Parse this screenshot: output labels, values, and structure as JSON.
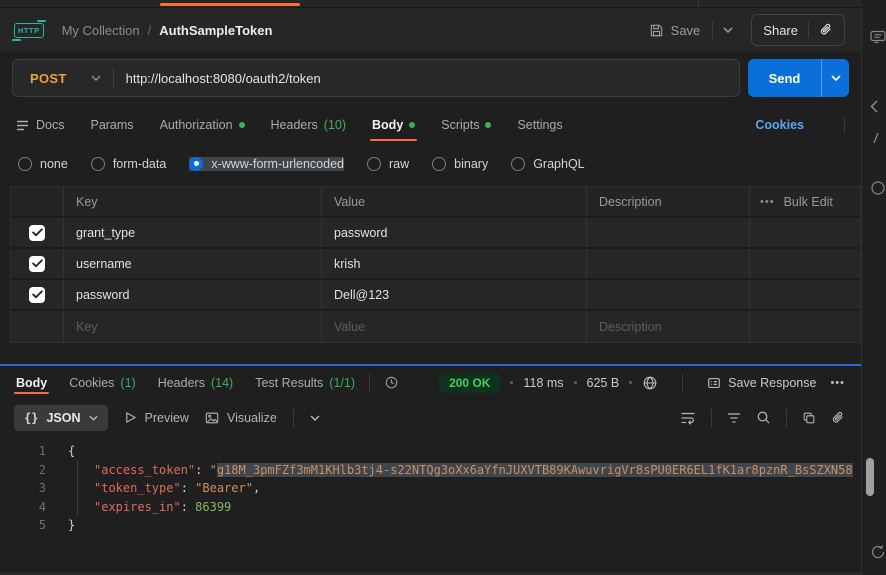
{
  "topbar": {
    "breadcrumb_collection": "My Collection",
    "breadcrumb_separator": "/",
    "breadcrumb_request": "AuthSampleToken",
    "save_label": "Save",
    "share_label": "Share"
  },
  "request_bar": {
    "method": "POST",
    "url": "http://localhost:8080/oauth2/token",
    "send_label": "Send"
  },
  "request_tabs": {
    "docs_label": "Docs",
    "items": [
      {
        "label": "Params"
      },
      {
        "label": "Authorization",
        "dot": true
      },
      {
        "label": "Headers",
        "badge": "(10)"
      },
      {
        "label": "Body",
        "dot": true,
        "active": true
      },
      {
        "label": "Scripts",
        "dot": true
      },
      {
        "label": "Settings"
      }
    ],
    "cookies_link": "Cookies"
  },
  "body_types": {
    "options": [
      {
        "label": "none"
      },
      {
        "label": "form-data"
      },
      {
        "label": "x-www-form-urlencoded",
        "selected": true
      },
      {
        "label": "raw"
      },
      {
        "label": "binary"
      },
      {
        "label": "GraphQL"
      }
    ]
  },
  "form_table": {
    "headers": {
      "key": "Key",
      "value": "Value",
      "description": "Description",
      "bulk_edit": "Bulk Edit"
    },
    "rows": [
      {
        "key": "grant_type",
        "value": "password",
        "description": "",
        "checked": true
      },
      {
        "key": "username",
        "value": "krish",
        "description": "",
        "checked": true
      },
      {
        "key": "password",
        "value": "Dell@123",
        "description": "",
        "checked": true
      }
    ],
    "placeholder_row": {
      "key": "Key",
      "value": "Value",
      "description": "Description"
    }
  },
  "response": {
    "tabs": [
      {
        "label": "Body",
        "active": true
      },
      {
        "label": "Cookies",
        "badge": "(1)"
      },
      {
        "label": "Headers",
        "badge": "(14)"
      },
      {
        "label": "Test Results",
        "badge": "(1/1)"
      }
    ],
    "status": "200 OK",
    "time": "118 ms",
    "size": "625 B",
    "save_response_label": "Save Response",
    "format_label": "JSON",
    "preview_label": "Preview",
    "visualize_label": "Visualize",
    "body": {
      "access_token": "g18M_3pmFZf3mM1KHlb3tj4-s22NTQg3oXx6aYfnJUXVTB89KAwuvrigVr8sPU0ER6EL1fK1ar8pznR_BsSZXN58",
      "token_type": "Bearer",
      "expires_in": 86399
    },
    "code_lines": [
      {
        "num": "1",
        "indent": false,
        "segments": [
          {
            "t": "{",
            "c": "punc"
          }
        ]
      },
      {
        "num": "2",
        "indent": true,
        "segments": [
          {
            "t": "\"access_token\"",
            "c": "key"
          },
          {
            "t": ": ",
            "c": "punc"
          },
          {
            "t": "\"",
            "c": "str"
          },
          {
            "t": "g18M_3pmFZf3mM1KHlb3tj4-s22NTQg3oXx6aYfnJUXVTB89KAwuvrigVr8sPU0ER6EL1fK1ar8pznR_BsSZXN58",
            "c": "str sel"
          }
        ]
      },
      {
        "num": "3",
        "indent": true,
        "segments": [
          {
            "t": "\"token_type\"",
            "c": "key"
          },
          {
            "t": ": ",
            "c": "punc"
          },
          {
            "t": "\"Bearer\"",
            "c": "str"
          },
          {
            "t": ",",
            "c": "punc"
          }
        ]
      },
      {
        "num": "4",
        "indent": true,
        "segments": [
          {
            "t": "\"expires_in\"",
            "c": "key"
          },
          {
            "t": ": ",
            "c": "punc"
          },
          {
            "t": "86399",
            "c": "num"
          }
        ]
      },
      {
        "num": "5",
        "indent": false,
        "segments": [
          {
            "t": "}",
            "c": "punc"
          }
        ]
      }
    ]
  },
  "icons": {
    "more_horizontal": "•••",
    "braces": "{}",
    "http_badge": "HTTP"
  },
  "colors": {
    "accent_orange": "#ff6c37",
    "method_post": "#eea23d",
    "primary_blue": "#0b6fdb",
    "success_green": "#3faf5f",
    "status_badge_bg": "#11301d",
    "status_badge_text": "#41d058",
    "link_blue": "#58a6f0",
    "splitter_blue": "#2f6bd8"
  }
}
